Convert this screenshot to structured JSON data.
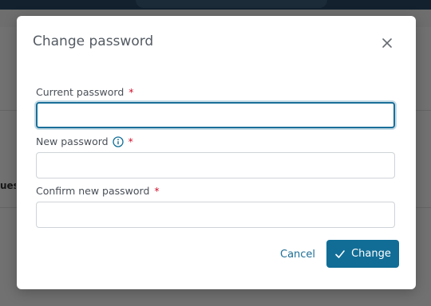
{
  "dialog": {
    "title": "Change password",
    "close_icon": "close-icon",
    "required_marker": "*",
    "fields": [
      {
        "label": "Current password",
        "value": "",
        "focused": true
      },
      {
        "label": "New password",
        "value": "",
        "has_info_icon": true
      },
      {
        "label": "Confirm new password",
        "value": ""
      }
    ],
    "cancel_label": "Cancel",
    "submit_label": "Change",
    "submit_icon": "check-icon"
  },
  "background": {
    "partial_text": "uest"
  },
  "colors": {
    "accent": "#116d96",
    "required": "#d0102b",
    "link": "#1e6e96"
  }
}
